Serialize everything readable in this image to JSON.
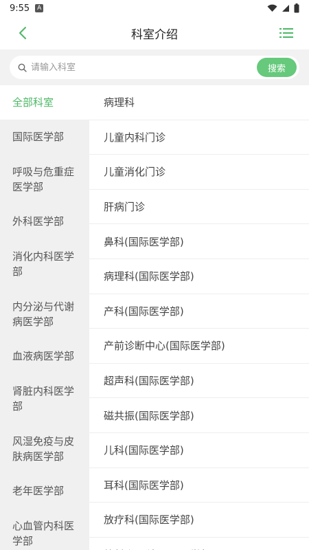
{
  "status_bar": {
    "time": "9:55",
    "notification_glyph": "A"
  },
  "header": {
    "title": "科室介绍"
  },
  "search": {
    "placeholder": "请输入科室",
    "button_label": "搜索"
  },
  "left_menu": [
    {
      "label": "全部科室",
      "active": true
    },
    {
      "label": "国际医学部"
    },
    {
      "label": "呼吸与危重症医学部"
    },
    {
      "label": "外科医学部"
    },
    {
      "label": "消化内科医学部"
    },
    {
      "label": "内分泌与代谢病医学部"
    },
    {
      "label": "血液病医学部"
    },
    {
      "label": "肾脏内科医学部"
    },
    {
      "label": "风湿免疫与皮肤病医学部"
    },
    {
      "label": "老年医学部"
    },
    {
      "label": "心血管内科医学部"
    }
  ],
  "departments": [
    "病理科",
    "儿童内科门诊",
    "儿童消化门诊",
    "肝病门诊",
    "鼻科(国际医学部)",
    "病理科(国际医学部)",
    "产科(国际医学部)",
    "产前诊断中心(国际医学部)",
    "超声科(国际医学部)",
    "磁共振(国际医学部)",
    "儿科(国际医学部)",
    "耳科(国际医学部)",
    "放疗科(国际医学部)",
    "放射介入科(国际医学部)"
  ],
  "colors": {
    "accent": "#4cb865",
    "search_button": "#66c97c",
    "sidebar_bg": "#f0f0f0"
  }
}
